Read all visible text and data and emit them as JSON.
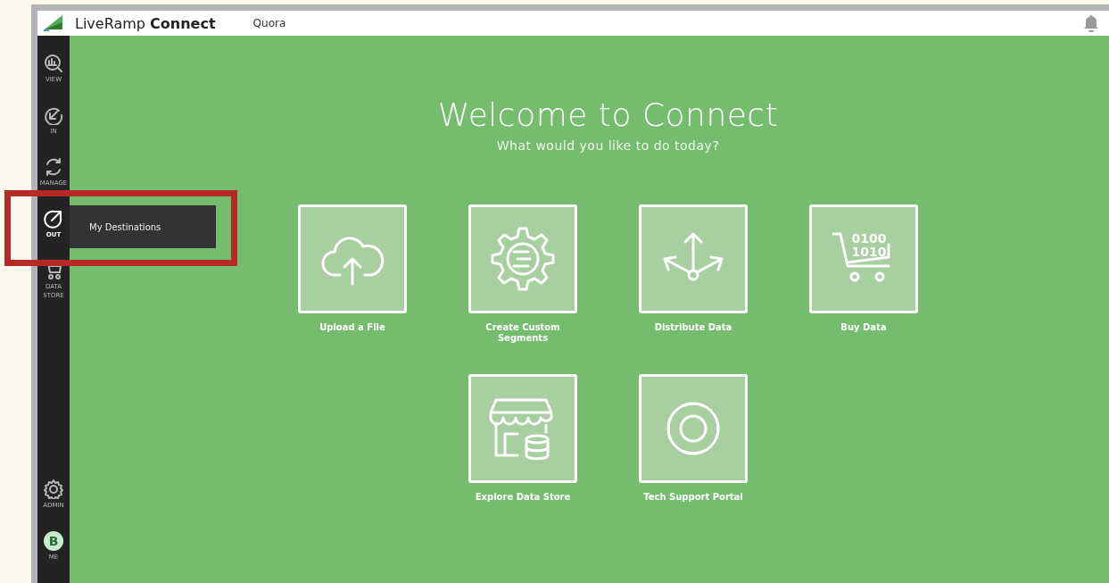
{
  "header": {
    "logo_light": "LiveRamp",
    "logo_bold": "Connect",
    "account": "Quora"
  },
  "sidebar": {
    "items": [
      {
        "label": "VIEW",
        "kind": "view",
        "selected": false
      },
      {
        "label": "IN",
        "kind": "in",
        "selected": false
      },
      {
        "label": "MANAGE",
        "kind": "manage",
        "selected": false
      },
      {
        "label": "OUT",
        "kind": "out",
        "selected": true
      },
      {
        "label": "DATA STORE",
        "kind": "store",
        "selected": false
      }
    ],
    "bottom_items": [
      {
        "label": "ADMIN",
        "kind": "gear"
      },
      {
        "label": "ME",
        "kind": "avatar",
        "initial": "B"
      }
    ]
  },
  "flyout": {
    "items": [
      "My Destinations"
    ]
  },
  "welcome": {
    "title": "Welcome to Connect",
    "subtitle": "What would you like to do today?"
  },
  "tiles": [
    {
      "label": "Upload a File",
      "kind": "upload"
    },
    {
      "label": "Create Custom Segments",
      "kind": "segments"
    },
    {
      "label": "Distribute Data",
      "kind": "distribute"
    },
    {
      "label": "Buy Data",
      "kind": "buy",
      "icon_text": [
        "0100",
        "1010"
      ]
    },
    {
      "label": "Explore Data Store",
      "kind": "explore"
    },
    {
      "label": "Tech Support Portal",
      "kind": "support"
    }
  ]
}
